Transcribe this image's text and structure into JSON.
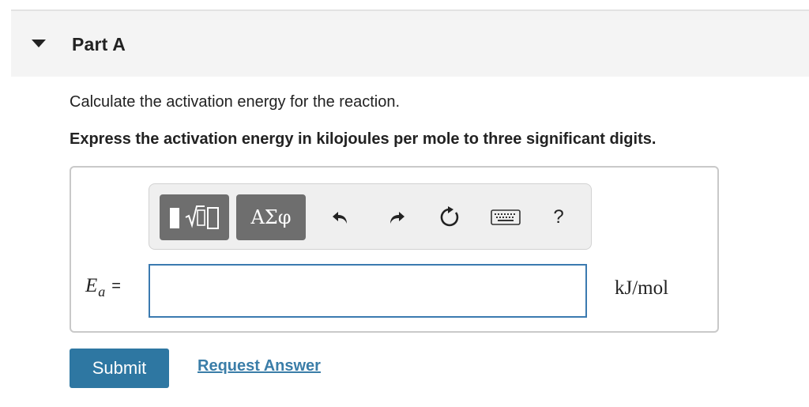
{
  "part": {
    "title": "Part A",
    "expanded_icon": "triangle-down-icon"
  },
  "question": {
    "prompt": "Calculate the activation energy for the reaction.",
    "instruction": "Express the activation energy in kilojoules per mole to three significant digits."
  },
  "toolbar": {
    "templates_icon": "templates-icon",
    "symbols_label": "ΑΣφ",
    "undo_icon": "undo-icon",
    "redo_icon": "redo-icon",
    "reset_icon": "reset-icon",
    "keyboard_icon": "keyboard-icon",
    "help_label": "?"
  },
  "answer": {
    "variable": "E",
    "subscript": "a",
    "equals": "=",
    "value": "",
    "units": "kJ/mol"
  },
  "actions": {
    "submit_label": "Submit",
    "request_answer_label": "Request Answer"
  },
  "colors": {
    "header_bg": "#f4f4f4",
    "toolbar_button": "#6e6e6e",
    "input_border": "#3b7ab0",
    "submit_bg": "#2e77a2",
    "link": "#3a7da8"
  }
}
